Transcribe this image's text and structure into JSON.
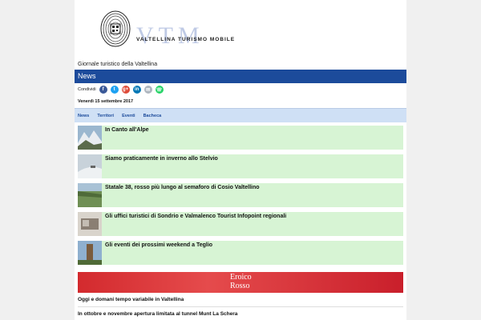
{
  "brand": {
    "letters": "VTM",
    "name": "VALTELLINA TURISMO MOBILE"
  },
  "subtitle": "Giornale turistico della Valtellina",
  "section_title": "News",
  "share": {
    "label": "Condividi",
    "icons": [
      "facebook-icon",
      "twitter-icon",
      "google-plus-icon",
      "linkedin-icon",
      "email-icon",
      "whatsapp-icon"
    ],
    "colors": [
      "#3b5998",
      "#1da1f2",
      "#dd4b39",
      "#0077b5",
      "#aeb6bf",
      "#25d366"
    ]
  },
  "date": "Venerdì 15 settembre 2017",
  "tabs": [
    "News",
    "Territori",
    "Eventi",
    "Bacheca"
  ],
  "items": [
    {
      "title": "In Canto all'Alpe"
    },
    {
      "title": "Siamo praticamente in inverno allo Stelvio"
    },
    {
      "title": "Statale 38, rosso più lungo al semaforo di Cosio Valtellino"
    },
    {
      "title": "Gli uffici turistici di Sondrio e Valmalenco Tourist Infopoint regionali"
    },
    {
      "title": "Gli eventi dei prossimi weekend a Teglio"
    }
  ],
  "banner": {
    "line1": "Eroico",
    "line2": "Rosso"
  },
  "headlines": [
    "Oggi e domani tempo variabile in Valtellina",
    "In ottobre e novembre apertura limitata al tunnel Munt La Schera"
  ],
  "colors": {
    "accent": "#1c4b9b",
    "item_bg": "#d7f4d4",
    "tabs_bg": "#cfe0f5"
  }
}
